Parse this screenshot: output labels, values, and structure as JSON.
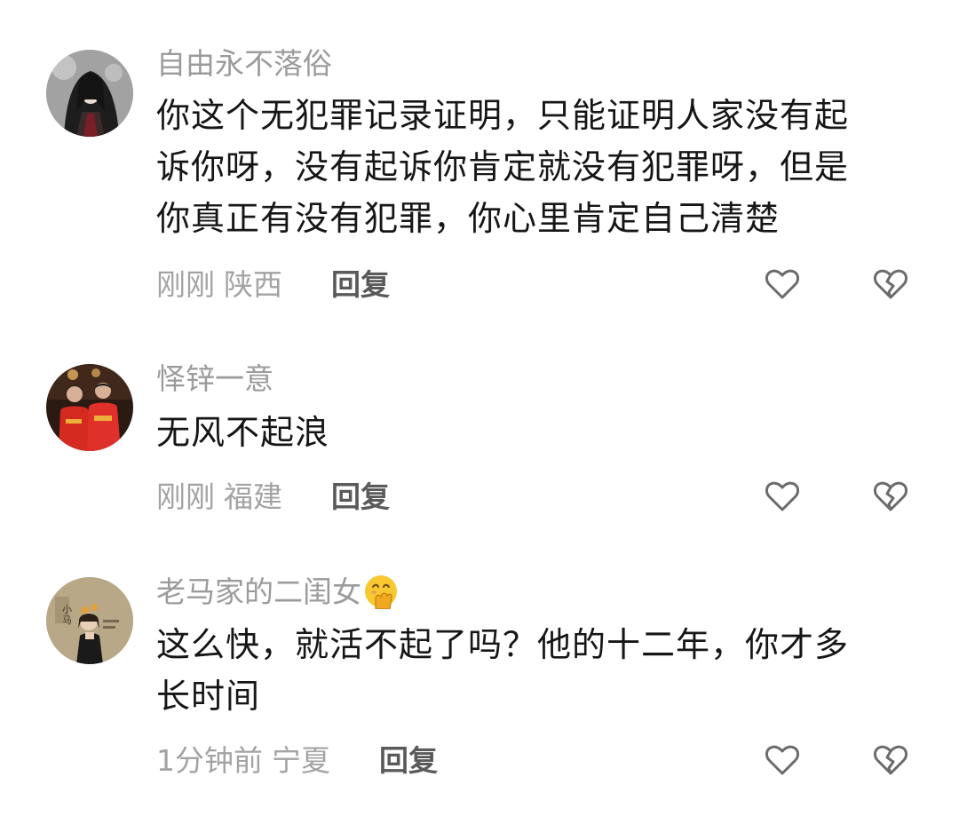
{
  "comments": [
    {
      "username": "自由永不落俗",
      "avatar": "avatar-dark-hair-woman",
      "lines": [
        "你这个无犯罪记录证明，只能证明人家没有起",
        "诉你呀，没有起诉你肯定就没有犯罪呀，但是",
        "你真正有没有犯罪，你心里肯定自己清楚"
      ],
      "time": "刚刚",
      "location": "陕西",
      "reply_label": "回复"
    },
    {
      "username": "怿锌一意",
      "avatar": "avatar-two-people-red-shirts",
      "lines": [
        "无风不起浪"
      ],
      "time": "刚刚",
      "location": "福建",
      "reply_label": "回复"
    },
    {
      "username": "老马家的二闺女",
      "username_emoji": "hand-over-mouth-emoji",
      "avatar": "avatar-illustrated-girl",
      "lines": [
        "这么快，就活不起了吗？他的十二年，你才多",
        "长时间"
      ],
      "time": "1分钟前",
      "location": "宁夏",
      "reply_label": "回复"
    }
  ],
  "icons": {
    "like": "heart-outline-icon",
    "dislike": "broken-heart-outline-icon"
  },
  "colors": {
    "username": "#9b9b9b",
    "text": "#161616",
    "meta": "#a3a3a3",
    "reply": "#5a5a5a",
    "icon": "#6b6b6b"
  }
}
